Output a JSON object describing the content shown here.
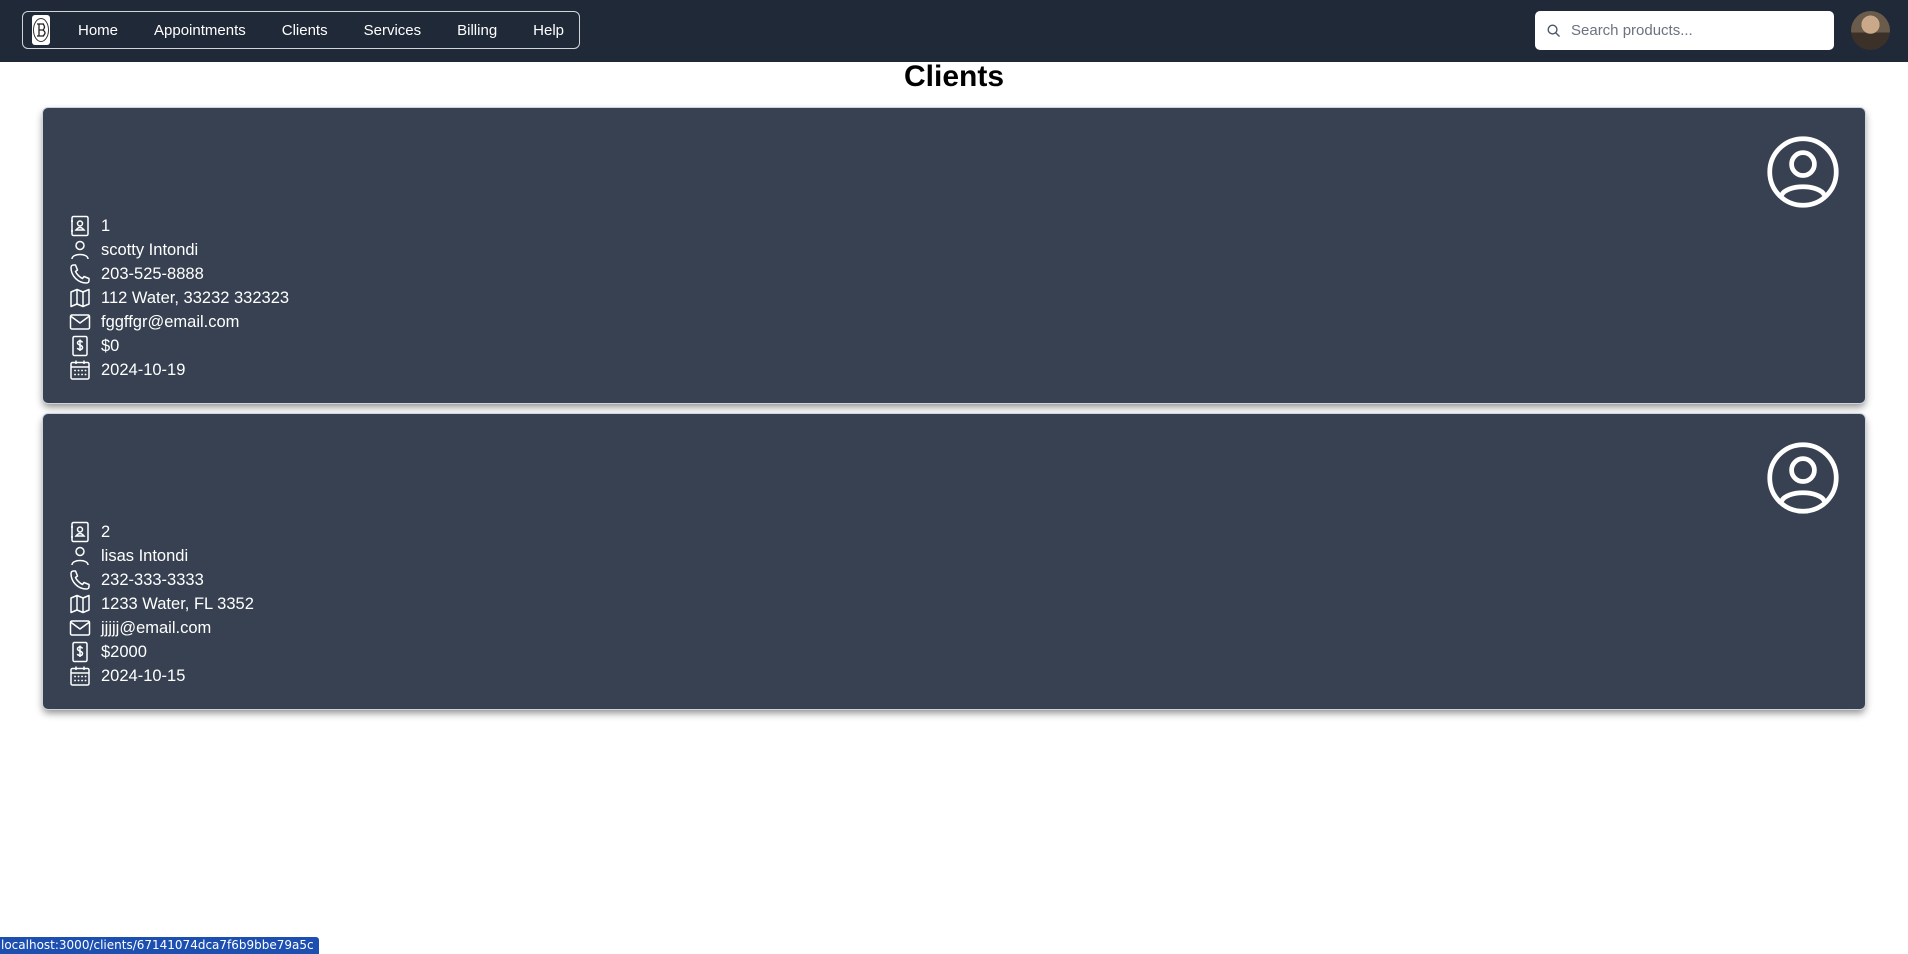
{
  "nav": {
    "items": [
      "Home",
      "Appointments",
      "Clients",
      "Services",
      "Billing",
      "Help"
    ]
  },
  "search": {
    "placeholder": "Search products..."
  },
  "page": {
    "title": "Clients"
  },
  "clients": [
    {
      "id": "1",
      "name": "scotty Intondi",
      "phone": "203-525-8888",
      "address": "112 Water, 33232 332323",
      "email": "fggffgr@email.com",
      "balance": "$0",
      "date": "2024-10-19"
    },
    {
      "id": "2",
      "name": "lisas Intondi",
      "phone": "232-333-3333",
      "address": "1233 Water, FL 3352",
      "email": "jjjjj@email.com",
      "balance": "$2000",
      "date": "2024-10-15"
    }
  ],
  "status_url": "localhost:3000/clients/67141074dca7f6b9bbe79a5c",
  "colors": {
    "topbar": "#1f2937",
    "card": "#374151",
    "status": "#1c4fb0"
  }
}
